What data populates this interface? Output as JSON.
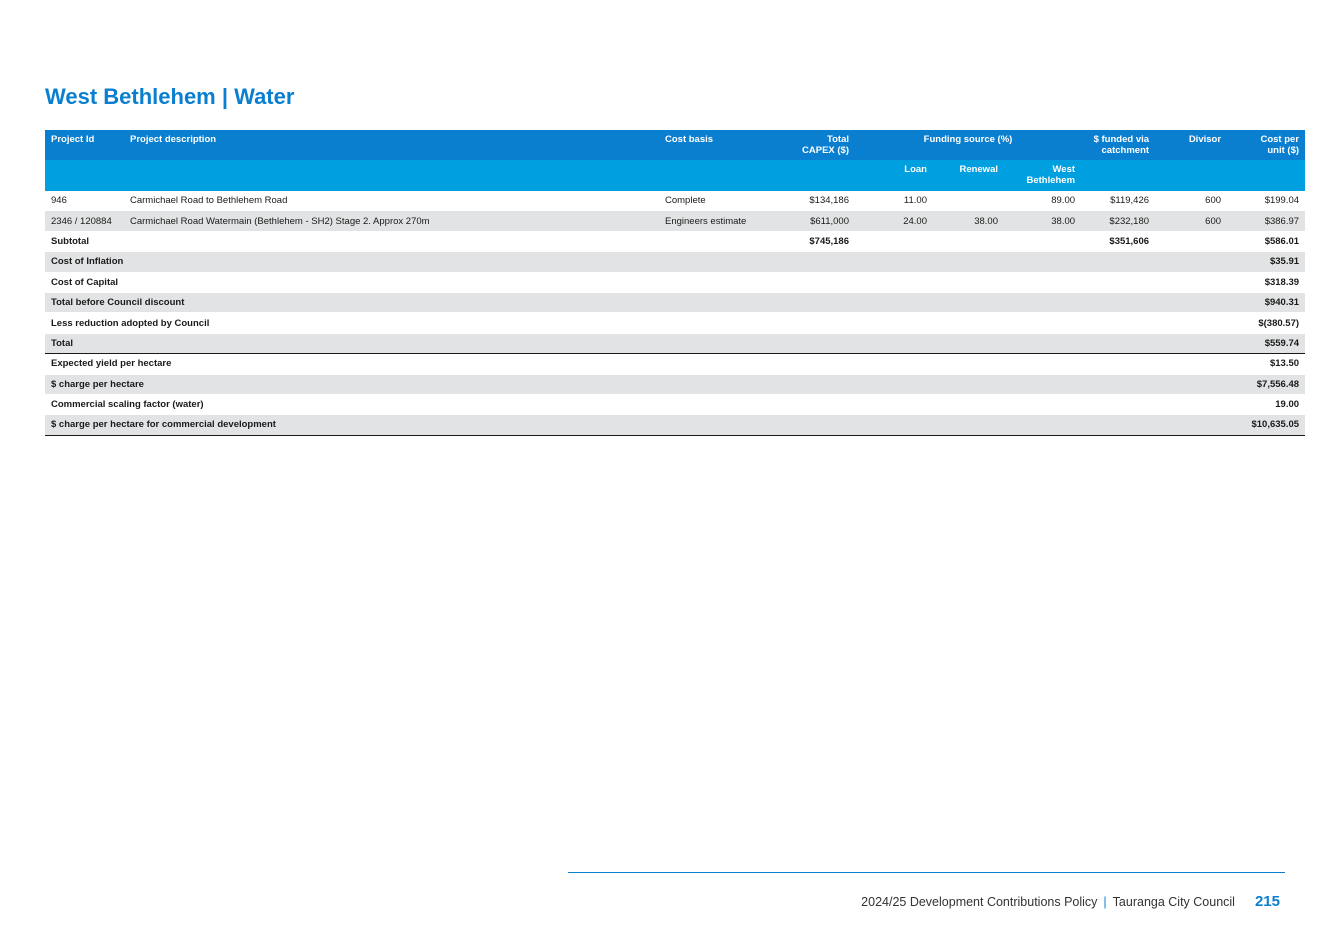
{
  "page": {
    "title": "West Bethlehem | Water"
  },
  "table": {
    "headers": {
      "project_id": "Project Id",
      "project_description": "Project description",
      "cost_basis": "Cost basis",
      "total_capex_line1": "Total",
      "total_capex_line2": "CAPEX ($)",
      "funding_source": "Funding source (%)",
      "funded_via_line1": "$ funded via",
      "funded_via_line2": "catchment",
      "divisor": "Divisor",
      "cost_per_unit_line1": "Cost per",
      "cost_per_unit_line2": "unit ($)",
      "loan": "Loan",
      "renewal": "Renewal",
      "west_line1": "West",
      "west_line2": "Bethlehem"
    },
    "rows": [
      {
        "project_id": "946",
        "description": "Carmichael Road to Bethlehem Road",
        "cost_basis": "Complete",
        "total_capex": "$134,186",
        "loan": "11.00",
        "renewal": "",
        "west": "89.00",
        "funded": "$119,426",
        "divisor": "600",
        "cost_per_unit": "$199.04"
      },
      {
        "project_id": "2346 / 120884",
        "description": "Carmichael Road Watermain (Bethlehem - SH2) Stage 2. Approx 270m",
        "cost_basis": "Engineers estimate",
        "total_capex": "$611,000",
        "loan": "24.00",
        "renewal": "38.00",
        "west": "38.00",
        "funded": "$232,180",
        "divisor": "600",
        "cost_per_unit": "$386.97"
      }
    ],
    "subtotal": {
      "label": "Subtotal",
      "total_capex": "$745,186",
      "funded": "$351,606",
      "cost_per_unit": "$586.01"
    },
    "summary": [
      {
        "label": "Cost of Inflation",
        "value": "$35.91"
      },
      {
        "label": "Cost of Capital",
        "value": "$318.39"
      },
      {
        "label": "Total before Council discount",
        "value": "$940.31"
      },
      {
        "label": "Less reduction adopted by Council",
        "value": "$(380.57)"
      },
      {
        "label": "Total",
        "value": "$559.74"
      }
    ],
    "charges": [
      {
        "label": "Expected yield per hectare",
        "value": "$13.50"
      },
      {
        "label": "$ charge per hectare",
        "value": "$7,556.48"
      },
      {
        "label": "Commercial scaling factor (water)",
        "value": "19.00"
      },
      {
        "label": "$ charge per hectare for commercial development",
        "value": "$10,635.05"
      }
    ]
  },
  "footer": {
    "document": "2024/25 Development Contributions Policy",
    "separator": "|",
    "council": "Tauranga City Council",
    "page_number": "215"
  },
  "colors": {
    "header_dark": "#0a7fcf",
    "header_light": "#009fdf",
    "row_shade": "#e2e3e4"
  }
}
